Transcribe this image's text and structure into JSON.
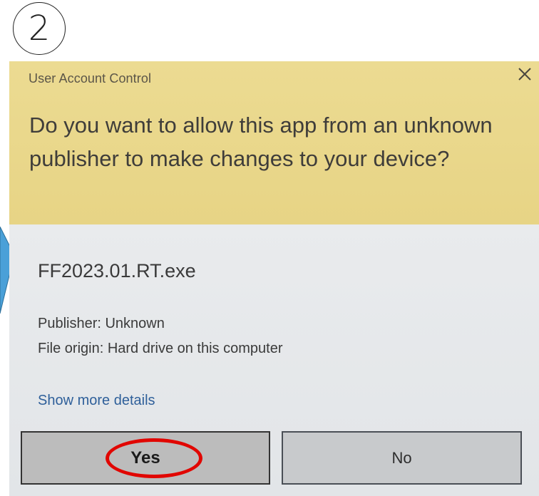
{
  "annotation": {
    "step_number": "2"
  },
  "dialog": {
    "title": "User Account Control",
    "question": "Do you want to allow this app from an unknown publisher to make changes to your device?",
    "file_name": "FF2023.01.RT.exe",
    "publisher": "Publisher: Unknown",
    "file_origin": "File origin: Hard drive on this computer",
    "details_link": "Show more details",
    "yes_label": "Yes",
    "no_label": "No"
  },
  "colors": {
    "header_bg": "#e9d88b",
    "body_bg": "#e6e8ea",
    "highlight": "#e10600",
    "link": "#2e5f9a",
    "arrow": "#4aa0d8"
  },
  "icons": {
    "close": "close-icon",
    "arrow": "right-arrow-icon"
  }
}
